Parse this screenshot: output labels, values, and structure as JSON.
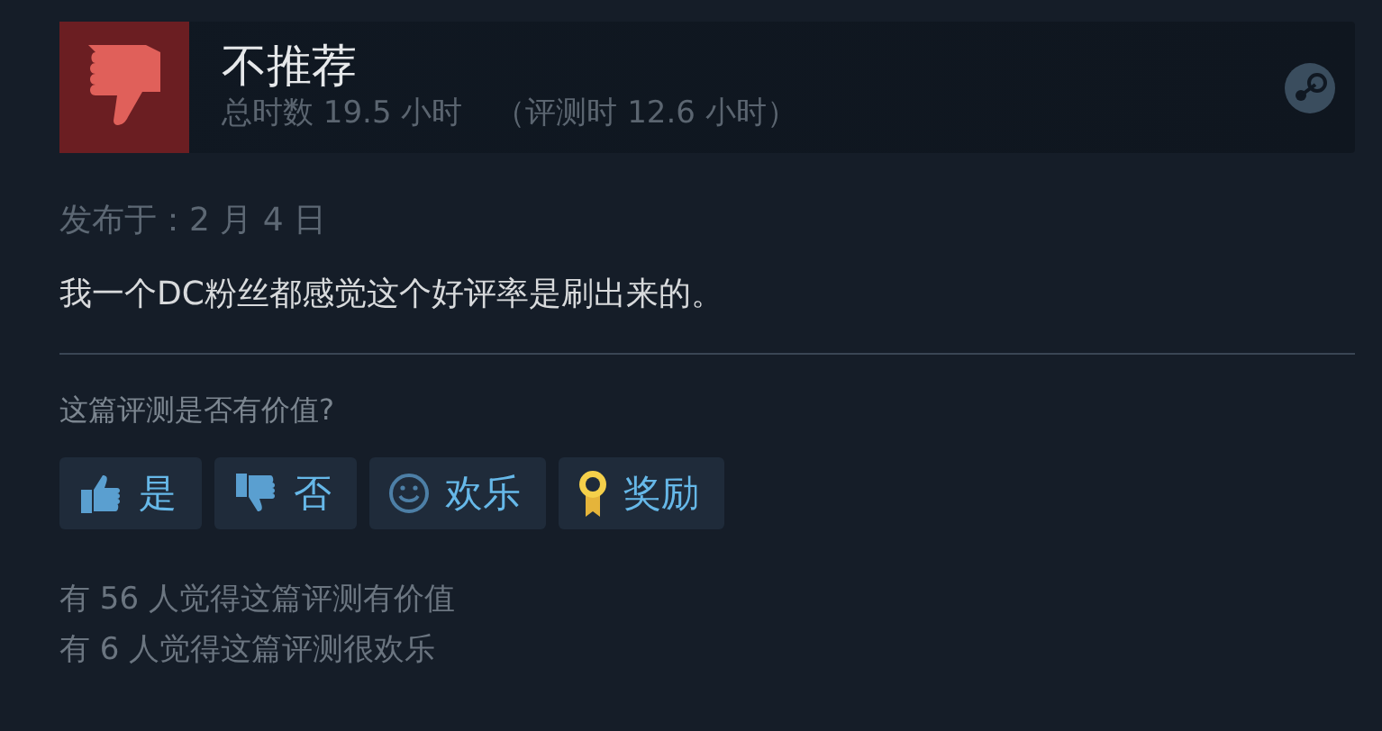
{
  "review": {
    "verdict": "不推荐",
    "recommended": false,
    "hours": "总时数 19.5 小时",
    "review_hours": "（评测时 12.6 小时）",
    "posted": "发布于：2 月 4 日",
    "text": "我一个DC粉丝都感觉这个好评率是刷出来的。"
  },
  "helpful": {
    "question": "这篇评测是否有价值?",
    "buttons": [
      {
        "kind": "yes",
        "label": "是"
      },
      {
        "kind": "no",
        "label": "否"
      },
      {
        "kind": "funny",
        "label": "欢乐"
      },
      {
        "kind": "award",
        "label": "奖励"
      }
    ],
    "stats": [
      "有 56 人觉得这篇评测有价值",
      "有 6 人觉得这篇评测很欢乐"
    ]
  }
}
